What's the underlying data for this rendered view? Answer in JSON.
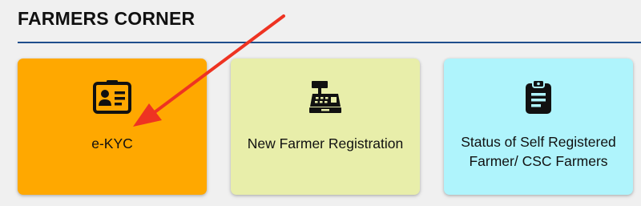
{
  "section": {
    "title": "FARMERS CORNER"
  },
  "cards": [
    {
      "label": "e-KYC",
      "icon": "id-card-icon",
      "color": "#ffa800"
    },
    {
      "label": "New Farmer Registration",
      "icon": "cash-register-icon",
      "color": "#e8eeaa"
    },
    {
      "label": "Status of Self Registered Farmer/ CSC Farmers",
      "icon": "clipboard-icon",
      "color": "#aff4fc"
    }
  ],
  "colors": {
    "rule": "#1f4e8c",
    "annotation_arrow": "#ee3322"
  }
}
